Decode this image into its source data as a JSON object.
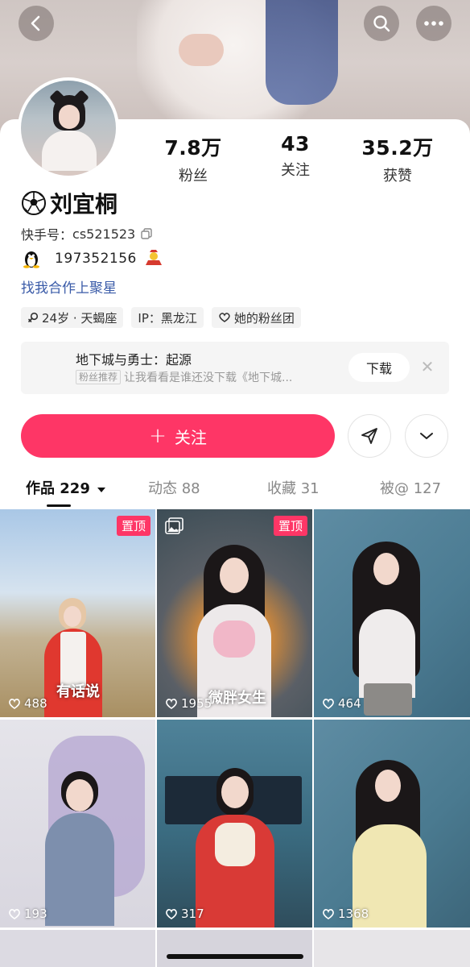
{
  "header": {
    "back_icon": "chevron-left-icon",
    "search_icon": "search-icon",
    "more_icon": "more-dots-icon"
  },
  "profile": {
    "stats": [
      {
        "value": "7.8万",
        "label": "粉丝"
      },
      {
        "value": "43",
        "label": "关注"
      },
      {
        "value": "35.2万",
        "label": "获赞"
      }
    ],
    "name_emoji": "soccer-ball-icon",
    "name": "刘宜桐",
    "kuaishou_id_label": "快手号：",
    "kuaishou_id": "cs521523",
    "qq_number": "197352156",
    "business_link": "找我合作上聚星",
    "tags": [
      {
        "icon": "gender-female-icon",
        "text": "24岁 · 天蝎座"
      },
      {
        "icon": "",
        "text": "IP：黑龙江"
      },
      {
        "icon": "fan-club-icon",
        "text": "她的粉丝团"
      }
    ]
  },
  "recommendation": {
    "title": "地下城与勇士：起源",
    "badge": "粉丝推荐",
    "text": "让我看看是谁还没下载《地下城...",
    "download_label": "下载"
  },
  "actions": {
    "follow_label": "关注",
    "follow_icon": "plus-icon",
    "share_icon": "send-icon",
    "expand_icon": "chevron-down-icon",
    "accent_color": "#fe3666"
  },
  "tabs": [
    {
      "label": "作品 229",
      "active": true
    },
    {
      "label": "动态 88",
      "active": false
    },
    {
      "label": "收藏 31",
      "active": false
    },
    {
      "label": "被@ 127",
      "active": false
    }
  ],
  "videos": [
    {
      "likes": "488",
      "pinned": "置顶",
      "caption": "有话说"
    },
    {
      "likes": "1955",
      "pinned": "置顶",
      "caption": "微胖女生",
      "album_icon": "image-album-icon"
    },
    {
      "likes": "464",
      "pinned": "",
      "caption": ""
    },
    {
      "likes": "193",
      "pinned": "",
      "caption": ""
    },
    {
      "likes": "317",
      "pinned": "",
      "caption": ""
    },
    {
      "likes": "1368",
      "pinned": "",
      "caption": ""
    }
  ]
}
